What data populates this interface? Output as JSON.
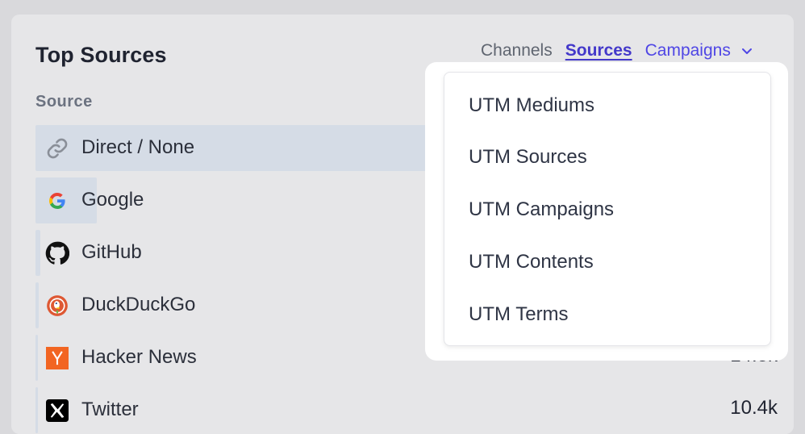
{
  "panel": {
    "title": "Top Sources",
    "column_header": "Source"
  },
  "tabs": [
    {
      "label": "Channels",
      "active": false
    },
    {
      "label": "Sources",
      "active": true
    },
    {
      "label": "Campaigns",
      "active": false
    }
  ],
  "sources": [
    {
      "label": "Direct / None",
      "icon": "link-icon",
      "value": ""
    },
    {
      "label": "Google",
      "icon": "google-icon",
      "value": ""
    },
    {
      "label": "GitHub",
      "icon": "github-icon",
      "value": ""
    },
    {
      "label": "DuckDuckGo",
      "icon": "duckduckgo-icon",
      "value": ""
    },
    {
      "label": "Hacker News",
      "icon": "hacker-news-icon",
      "value": "14.3k"
    },
    {
      "label": "Twitter",
      "icon": "x-twitter-icon",
      "value": "10.4k"
    }
  ],
  "dropdown": {
    "items": [
      "UTM Mediums",
      "UTM Sources",
      "UTM Campaigns",
      "UTM Contents",
      "UTM Terms"
    ]
  },
  "colors": {
    "accent": "#4f46e5",
    "bar": "#d5dce6",
    "hacker_news": "#f26522"
  }
}
